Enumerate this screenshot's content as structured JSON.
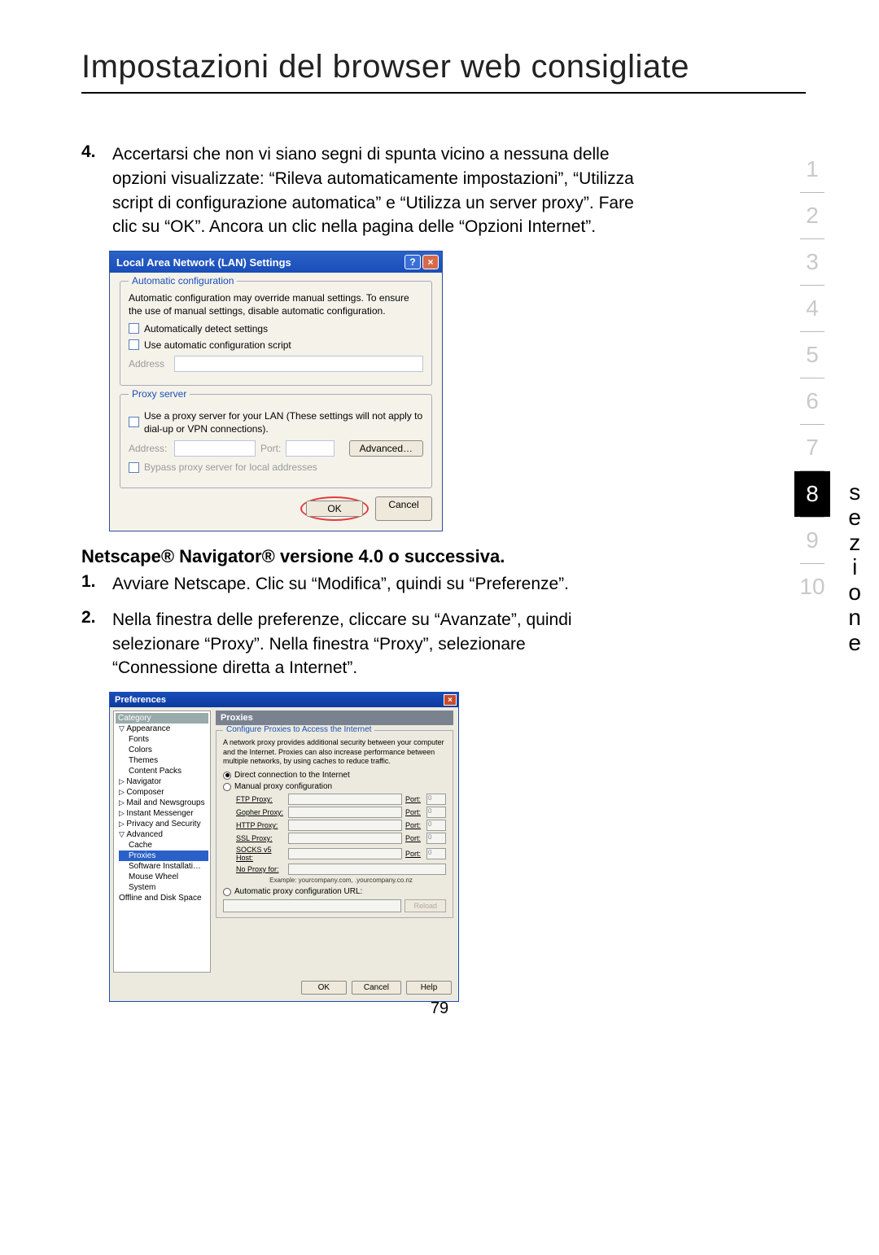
{
  "page": {
    "title": "Impostazioni del browser web consigliate",
    "number": "79",
    "side_label": "sezione"
  },
  "nav": {
    "items": [
      "1",
      "2",
      "3",
      "4",
      "5",
      "6",
      "7",
      "8",
      "9",
      "10"
    ],
    "active_index": 7
  },
  "step4": {
    "num": "4.",
    "text": "Accertarsi che non vi siano segni di spunta vicino a nessuna delle opzioni visualizzate: “Rileva automaticamente impostazioni”, “Utilizza script di configurazione automatica” e “Utilizza un server proxy”. Fare clic su “OK”. Ancora un clic nella pagina delle “Opzioni Internet”."
  },
  "lan": {
    "title": "Local Area Network (LAN) Settings",
    "autoconf_legend": "Automatic configuration",
    "autoconf_note": "Automatic configuration may override manual settings. To ensure the use of manual settings, disable automatic configuration.",
    "auto_detect": "Automatically detect settings",
    "use_script": "Use automatic configuration script",
    "address_label": "Address",
    "proxy_legend": "Proxy server",
    "proxy_text": "Use a proxy server for your LAN (These settings will not apply to dial-up or VPN connections).",
    "address2_label": "Address:",
    "port_label": "Port:",
    "advanced": "Advanced…",
    "bypass": "Bypass proxy server for local addresses",
    "ok": "OK",
    "cancel": "Cancel"
  },
  "netscape_heading": "Netscape® Navigator® versione 4.0 o successiva.",
  "ns_step1": {
    "num": "1.",
    "text": "Avviare Netscape. Clic su “Modifica”, quindi su “Preferenze”."
  },
  "ns_step2": {
    "num": "2.",
    "text": "Nella finestra delle preferenze, cliccare su “Avanzate”, quindi selezionare “Proxy”. Nella finestra “Proxy”, selezionare “Connessione diretta a Internet”."
  },
  "ns": {
    "title": "Preferences",
    "tree_title": "Category",
    "tree": {
      "appearance": "Appearance",
      "fonts": "Fonts",
      "colors": "Colors",
      "themes": "Themes",
      "content_packs": "Content Packs",
      "navigator": "Navigator",
      "composer": "Composer",
      "mail": "Mail and Newsgroups",
      "im": "Instant Messenger",
      "privacy": "Privacy and Security",
      "advanced": "Advanced",
      "cache": "Cache",
      "proxies": "Proxies",
      "software": "Software Installati…",
      "mouse": "Mouse Wheel",
      "system": "System",
      "offline": "Offline and Disk Space"
    },
    "panel_title": "Proxies",
    "fs_legend": "Configure Proxies to Access the Internet",
    "note": "A network proxy provides additional security between your computer and the Internet. Proxies can also increase performance between multiple networks, by using caches to reduce traffic.",
    "r_direct": "Direct connection to the Internet",
    "r_manual": "Manual proxy configuration",
    "ftp": "FTP Proxy:",
    "gopher": "Gopher Proxy:",
    "http": "HTTP Proxy:",
    "ssl": "SSL Proxy:",
    "socks": "SOCKS v5 Host:",
    "noproxy": "No Proxy for:",
    "port": "Port:",
    "portval": "0",
    "example": "Example: yourcompany.com, .yourcompany.co.nz",
    "r_auto": "Automatic proxy configuration URL:",
    "reload": "Reload",
    "ok": "OK",
    "cancel": "Cancel",
    "help": "Help"
  }
}
